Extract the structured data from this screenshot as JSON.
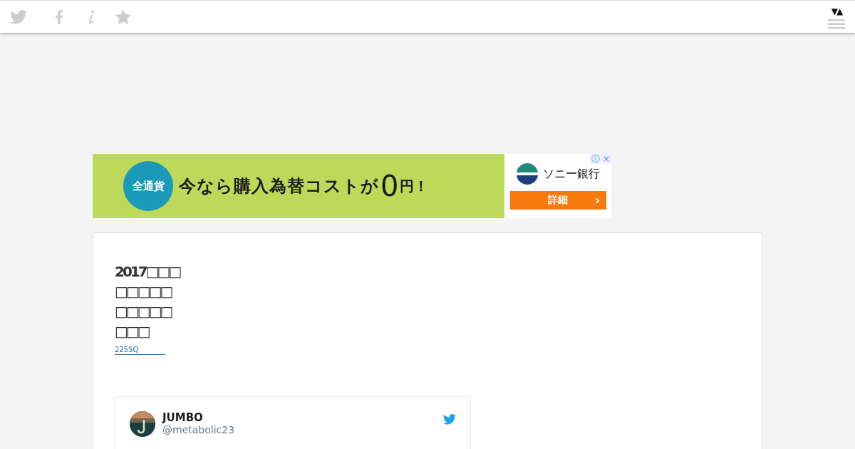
{
  "toolbar": {
    "menu_toggle": "▼▲"
  },
  "ad": {
    "badge": "全通貨",
    "headline": "今なら購入為替コストが",
    "amount": "0",
    "unit": "円！",
    "bank": "ソニー銀行",
    "button": "詳細",
    "button_arrow": "›",
    "info_icon": "ⓘ",
    "close_icon": "×"
  },
  "article": {
    "title": "2017□□□□□□□□□□□□□□□□",
    "source_link": "225SQ"
  },
  "tweet": {
    "name": "JUMBO",
    "handle": "@metabolic23"
  }
}
